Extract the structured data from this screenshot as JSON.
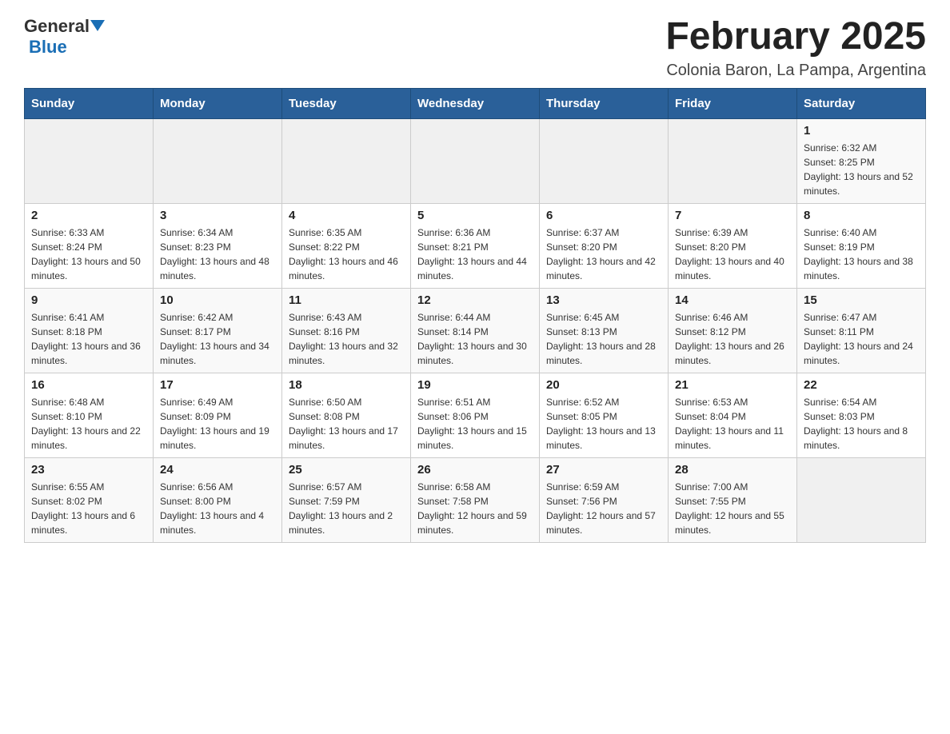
{
  "header": {
    "logo_general": "General",
    "logo_blue": "Blue",
    "month_title": "February 2025",
    "subtitle": "Colonia Baron, La Pampa, Argentina"
  },
  "weekdays": [
    "Sunday",
    "Monday",
    "Tuesday",
    "Wednesday",
    "Thursday",
    "Friday",
    "Saturday"
  ],
  "weeks": [
    [
      {
        "day": "",
        "sunrise": "",
        "sunset": "",
        "daylight": ""
      },
      {
        "day": "",
        "sunrise": "",
        "sunset": "",
        "daylight": ""
      },
      {
        "day": "",
        "sunrise": "",
        "sunset": "",
        "daylight": ""
      },
      {
        "day": "",
        "sunrise": "",
        "sunset": "",
        "daylight": ""
      },
      {
        "day": "",
        "sunrise": "",
        "sunset": "",
        "daylight": ""
      },
      {
        "day": "",
        "sunrise": "",
        "sunset": "",
        "daylight": ""
      },
      {
        "day": "1",
        "sunrise": "Sunrise: 6:32 AM",
        "sunset": "Sunset: 8:25 PM",
        "daylight": "Daylight: 13 hours and 52 minutes."
      }
    ],
    [
      {
        "day": "2",
        "sunrise": "Sunrise: 6:33 AM",
        "sunset": "Sunset: 8:24 PM",
        "daylight": "Daylight: 13 hours and 50 minutes."
      },
      {
        "day": "3",
        "sunrise": "Sunrise: 6:34 AM",
        "sunset": "Sunset: 8:23 PM",
        "daylight": "Daylight: 13 hours and 48 minutes."
      },
      {
        "day": "4",
        "sunrise": "Sunrise: 6:35 AM",
        "sunset": "Sunset: 8:22 PM",
        "daylight": "Daylight: 13 hours and 46 minutes."
      },
      {
        "day": "5",
        "sunrise": "Sunrise: 6:36 AM",
        "sunset": "Sunset: 8:21 PM",
        "daylight": "Daylight: 13 hours and 44 minutes."
      },
      {
        "day": "6",
        "sunrise": "Sunrise: 6:37 AM",
        "sunset": "Sunset: 8:20 PM",
        "daylight": "Daylight: 13 hours and 42 minutes."
      },
      {
        "day": "7",
        "sunrise": "Sunrise: 6:39 AM",
        "sunset": "Sunset: 8:20 PM",
        "daylight": "Daylight: 13 hours and 40 minutes."
      },
      {
        "day": "8",
        "sunrise": "Sunrise: 6:40 AM",
        "sunset": "Sunset: 8:19 PM",
        "daylight": "Daylight: 13 hours and 38 minutes."
      }
    ],
    [
      {
        "day": "9",
        "sunrise": "Sunrise: 6:41 AM",
        "sunset": "Sunset: 8:18 PM",
        "daylight": "Daylight: 13 hours and 36 minutes."
      },
      {
        "day": "10",
        "sunrise": "Sunrise: 6:42 AM",
        "sunset": "Sunset: 8:17 PM",
        "daylight": "Daylight: 13 hours and 34 minutes."
      },
      {
        "day": "11",
        "sunrise": "Sunrise: 6:43 AM",
        "sunset": "Sunset: 8:16 PM",
        "daylight": "Daylight: 13 hours and 32 minutes."
      },
      {
        "day": "12",
        "sunrise": "Sunrise: 6:44 AM",
        "sunset": "Sunset: 8:14 PM",
        "daylight": "Daylight: 13 hours and 30 minutes."
      },
      {
        "day": "13",
        "sunrise": "Sunrise: 6:45 AM",
        "sunset": "Sunset: 8:13 PM",
        "daylight": "Daylight: 13 hours and 28 minutes."
      },
      {
        "day": "14",
        "sunrise": "Sunrise: 6:46 AM",
        "sunset": "Sunset: 8:12 PM",
        "daylight": "Daylight: 13 hours and 26 minutes."
      },
      {
        "day": "15",
        "sunrise": "Sunrise: 6:47 AM",
        "sunset": "Sunset: 8:11 PM",
        "daylight": "Daylight: 13 hours and 24 minutes."
      }
    ],
    [
      {
        "day": "16",
        "sunrise": "Sunrise: 6:48 AM",
        "sunset": "Sunset: 8:10 PM",
        "daylight": "Daylight: 13 hours and 22 minutes."
      },
      {
        "day": "17",
        "sunrise": "Sunrise: 6:49 AM",
        "sunset": "Sunset: 8:09 PM",
        "daylight": "Daylight: 13 hours and 19 minutes."
      },
      {
        "day": "18",
        "sunrise": "Sunrise: 6:50 AM",
        "sunset": "Sunset: 8:08 PM",
        "daylight": "Daylight: 13 hours and 17 minutes."
      },
      {
        "day": "19",
        "sunrise": "Sunrise: 6:51 AM",
        "sunset": "Sunset: 8:06 PM",
        "daylight": "Daylight: 13 hours and 15 minutes."
      },
      {
        "day": "20",
        "sunrise": "Sunrise: 6:52 AM",
        "sunset": "Sunset: 8:05 PM",
        "daylight": "Daylight: 13 hours and 13 minutes."
      },
      {
        "day": "21",
        "sunrise": "Sunrise: 6:53 AM",
        "sunset": "Sunset: 8:04 PM",
        "daylight": "Daylight: 13 hours and 11 minutes."
      },
      {
        "day": "22",
        "sunrise": "Sunrise: 6:54 AM",
        "sunset": "Sunset: 8:03 PM",
        "daylight": "Daylight: 13 hours and 8 minutes."
      }
    ],
    [
      {
        "day": "23",
        "sunrise": "Sunrise: 6:55 AM",
        "sunset": "Sunset: 8:02 PM",
        "daylight": "Daylight: 13 hours and 6 minutes."
      },
      {
        "day": "24",
        "sunrise": "Sunrise: 6:56 AM",
        "sunset": "Sunset: 8:00 PM",
        "daylight": "Daylight: 13 hours and 4 minutes."
      },
      {
        "day": "25",
        "sunrise": "Sunrise: 6:57 AM",
        "sunset": "Sunset: 7:59 PM",
        "daylight": "Daylight: 13 hours and 2 minutes."
      },
      {
        "day": "26",
        "sunrise": "Sunrise: 6:58 AM",
        "sunset": "Sunset: 7:58 PM",
        "daylight": "Daylight: 12 hours and 59 minutes."
      },
      {
        "day": "27",
        "sunrise": "Sunrise: 6:59 AM",
        "sunset": "Sunset: 7:56 PM",
        "daylight": "Daylight: 12 hours and 57 minutes."
      },
      {
        "day": "28",
        "sunrise": "Sunrise: 7:00 AM",
        "sunset": "Sunset: 7:55 PM",
        "daylight": "Daylight: 12 hours and 55 minutes."
      },
      {
        "day": "",
        "sunrise": "",
        "sunset": "",
        "daylight": ""
      }
    ]
  ]
}
